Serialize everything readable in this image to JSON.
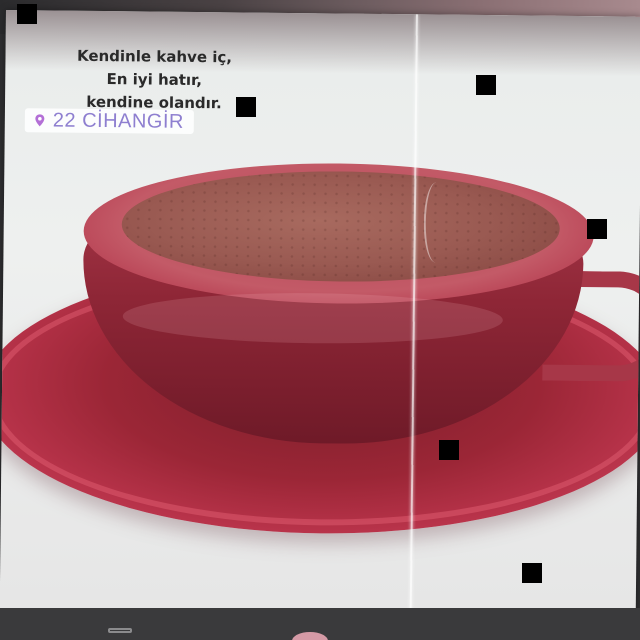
{
  "post": {
    "quote_lines": [
      "Kendinle kahve iç,",
      "En iyi hatır,",
      "kendine olandır."
    ],
    "location_label": "22 CİHANGİR",
    "location_color": "#8e7fd0"
  },
  "icons": {
    "location": "map-pin-icon",
    "nav_menu": "menu-icon",
    "nav_home": "home-icon"
  },
  "colors": {
    "cup": "#a73748",
    "saucer": "#b8334a",
    "background": "#2f2f31"
  }
}
